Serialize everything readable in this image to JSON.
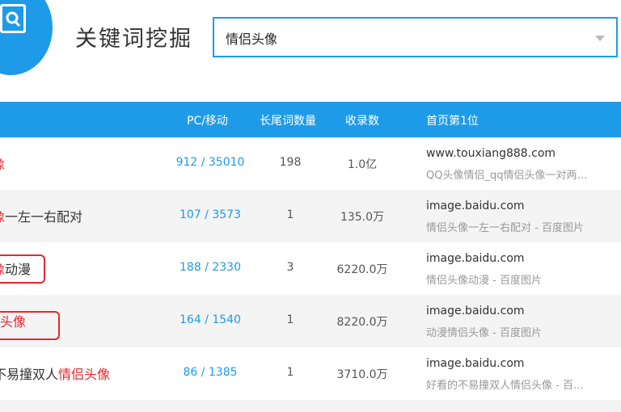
{
  "app": {
    "title": "关键词挖掘"
  },
  "search": {
    "value": "情侣头像"
  },
  "table": {
    "headers": [
      "PC/移动",
      "长尾词数量",
      "收录数",
      "首页第1位"
    ],
    "rows": [
      {
        "kw_prefix": "",
        "kw_red": "",
        "kw_plain_after": "",
        "kw_red_visible": "像",
        "pc": "912 / 35010",
        "tail": "198",
        "included": "1.0亿",
        "domain": "www.touxiang888.com",
        "desc": "QQ头像情侣_qq情侣头像一对两…"
      },
      {
        "kw": "一左一右配对",
        "kw_red_visible": "像",
        "pc": "107 / 3573",
        "tail": "1",
        "included": "135.0万",
        "domain": "image.baidu.com",
        "desc": "情侣头像一左一右配对 - 百度图片"
      },
      {
        "kw": "动漫",
        "kw_red_visible": "像",
        "pc": "188 / 2330",
        "tail": "3",
        "included": "6220.0万",
        "domain": "image.baidu.com",
        "desc": "情侣头像动漫 - 百度图片"
      },
      {
        "kw_red_visible": "侣头像",
        "pc": "164 / 1540",
        "tail": "1",
        "included": "8220.0万",
        "domain": "image.baidu.com",
        "desc": "动漫情侣头像 - 百度图片"
      },
      {
        "kw": "不易撞双人",
        "kw_red_visible": "情侣头像",
        "pc": "86 / 1385",
        "tail": "1",
        "included": "3710.0万",
        "domain": "image.baidu.com",
        "desc": "好看的不易撞双人情侣头像 - 百…"
      }
    ]
  },
  "colors": {
    "accent": "#1e9be8",
    "highlight": "#e8262d"
  },
  "icons": {
    "logo": "search-icon",
    "dropdown": "chevron-down-icon"
  }
}
